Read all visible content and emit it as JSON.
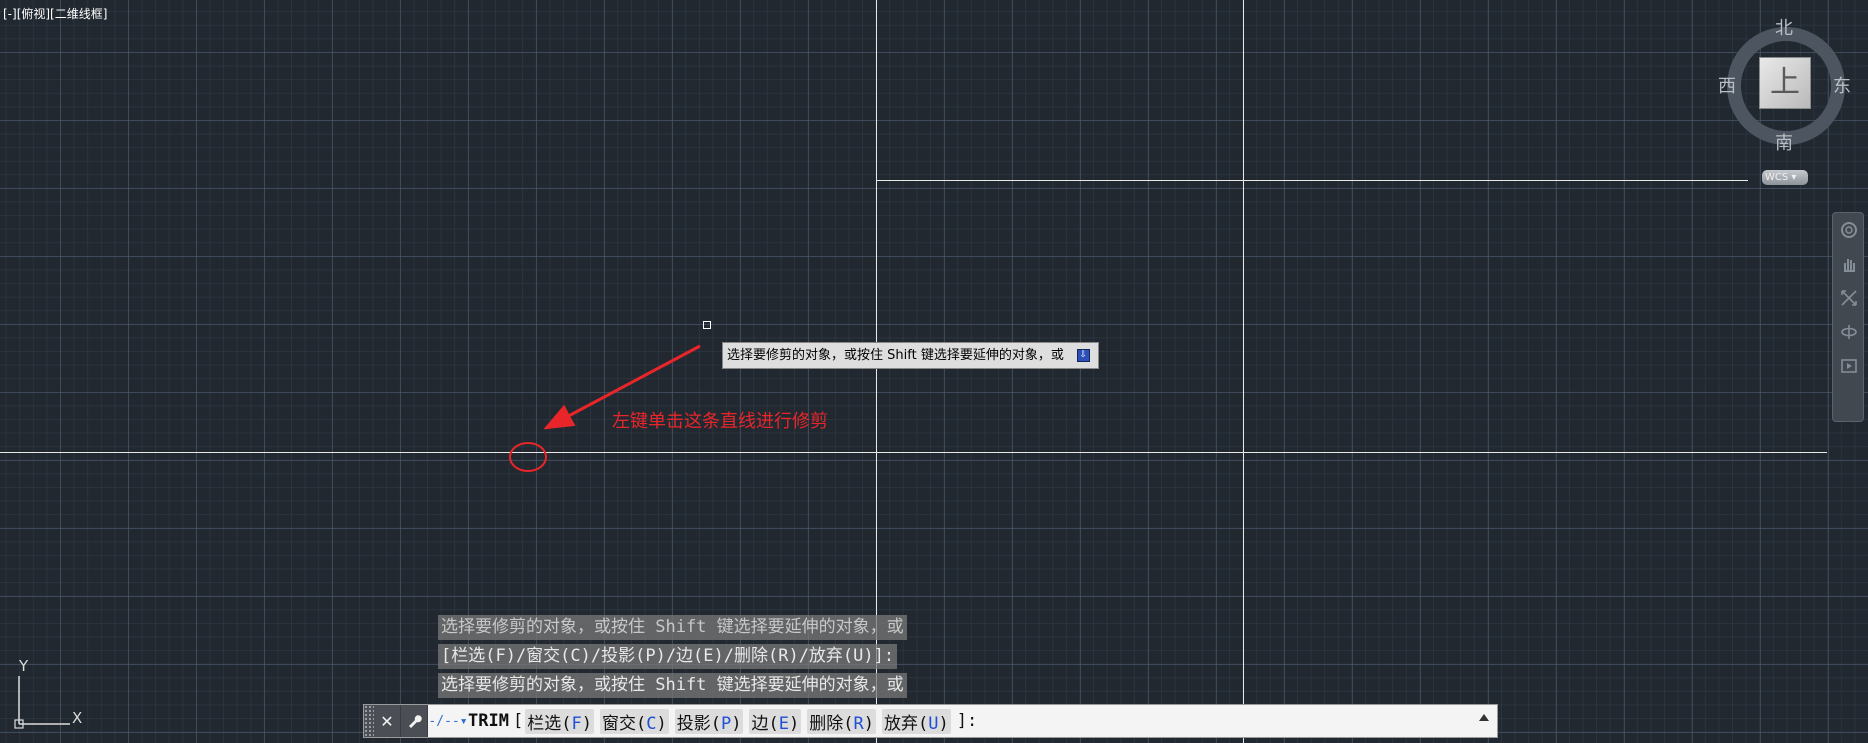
{
  "viewport": {
    "label": "[-][俯视][二维线框]"
  },
  "viewcube": {
    "top_face": "上",
    "north": "北",
    "south": "南",
    "east": "东",
    "west": "西",
    "wcs": "WCS"
  },
  "tooltip": {
    "text": "选择要修剪的对象，或按住 Shift 键选择要延伸的对象，或"
  },
  "annotation": {
    "text": "左键单击这条直线进行修剪",
    "color": "#e8262a"
  },
  "ucs": {
    "x_label": "X",
    "y_label": "Y"
  },
  "history": [
    "选择要修剪的对象，或按住 Shift 键选择要延伸的对象，或",
    "[栏选(F)/窗交(C)/投影(P)/边(E)/删除(R)/放弃(U)]:",
    "选择要修剪的对象，或按住 Shift 键选择要延伸的对象，或"
  ],
  "command": {
    "name": "TRIM",
    "open_bracket": "[",
    "options": [
      {
        "label": "栏选(",
        "key": "F",
        "end": ")"
      },
      {
        "label": "窗交(",
        "key": "C",
        "end": ")"
      },
      {
        "label": "投影(",
        "key": "P",
        "end": ")"
      },
      {
        "label": "边(",
        "key": "E",
        "end": ")"
      },
      {
        "label": "删除(",
        "key": "R",
        "end": ")"
      },
      {
        "label": "放弃(",
        "key": "U",
        "end": ")"
      }
    ],
    "close": "]:",
    "close_icon": "close-icon",
    "customize_icon": "wrench-icon",
    "prompt_icon": "command-prompt-icon"
  },
  "colors": {
    "background": "#212830",
    "line": "#e9e9e9",
    "annotation": "#e8262a",
    "option_key": "#1e4fd6"
  }
}
